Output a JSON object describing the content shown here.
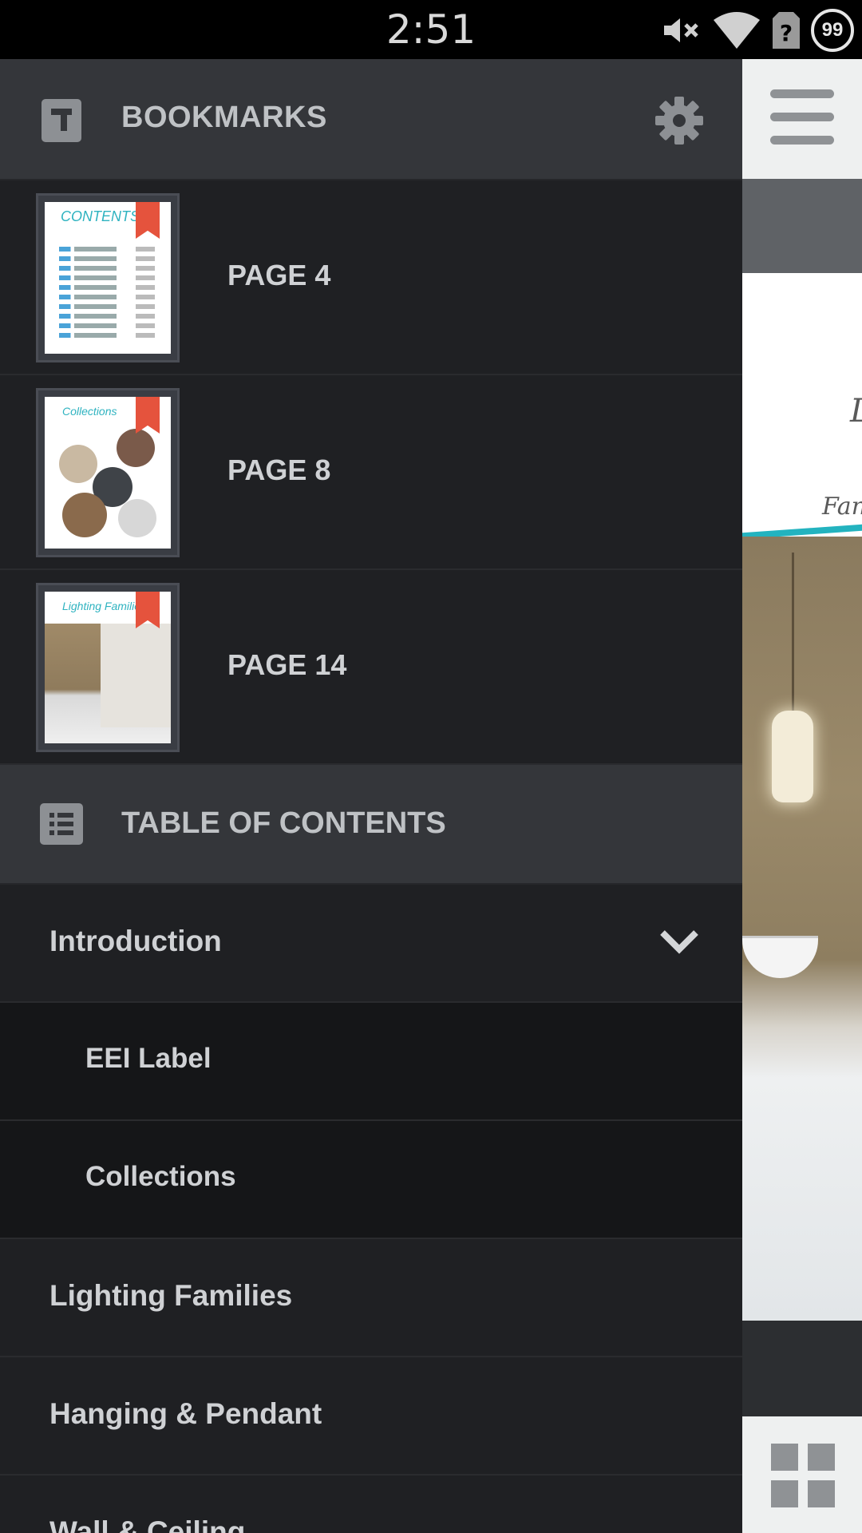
{
  "status_bar": {
    "time": "2:51",
    "battery_level": "99",
    "icons": [
      "mute-icon",
      "wifi-icon",
      "no-sim-icon",
      "battery-circle-icon"
    ]
  },
  "drawer": {
    "bookmarks_header": {
      "title": "BOOKMARKS",
      "icon": "bookmark-icon",
      "settings_icon": "gear-icon"
    },
    "bookmarks": [
      {
        "label": "PAGE 4"
      },
      {
        "label": "PAGE 8"
      },
      {
        "label": "PAGE 14"
      }
    ],
    "toc_header": {
      "title": "TABLE OF CONTENTS",
      "icon": "list-icon"
    },
    "toc": [
      {
        "label": "Introduction",
        "expanded": true
      },
      {
        "label": "EEI Label"
      },
      {
        "label": "Collections"
      },
      {
        "label": "Lighting Families"
      },
      {
        "label": "Hanging & Pendant"
      },
      {
        "label": "Wall & Ceiling"
      }
    ]
  },
  "viewer": {
    "page_text_1": "L",
    "page_text_2": "Fan",
    "menu_icon": "hamburger-menu-icon",
    "grid_icon": "grid-view-icon"
  },
  "colors": {
    "ribbon": "#e5533d",
    "accent": "#23b3bf",
    "header_bg": "#34363a"
  }
}
